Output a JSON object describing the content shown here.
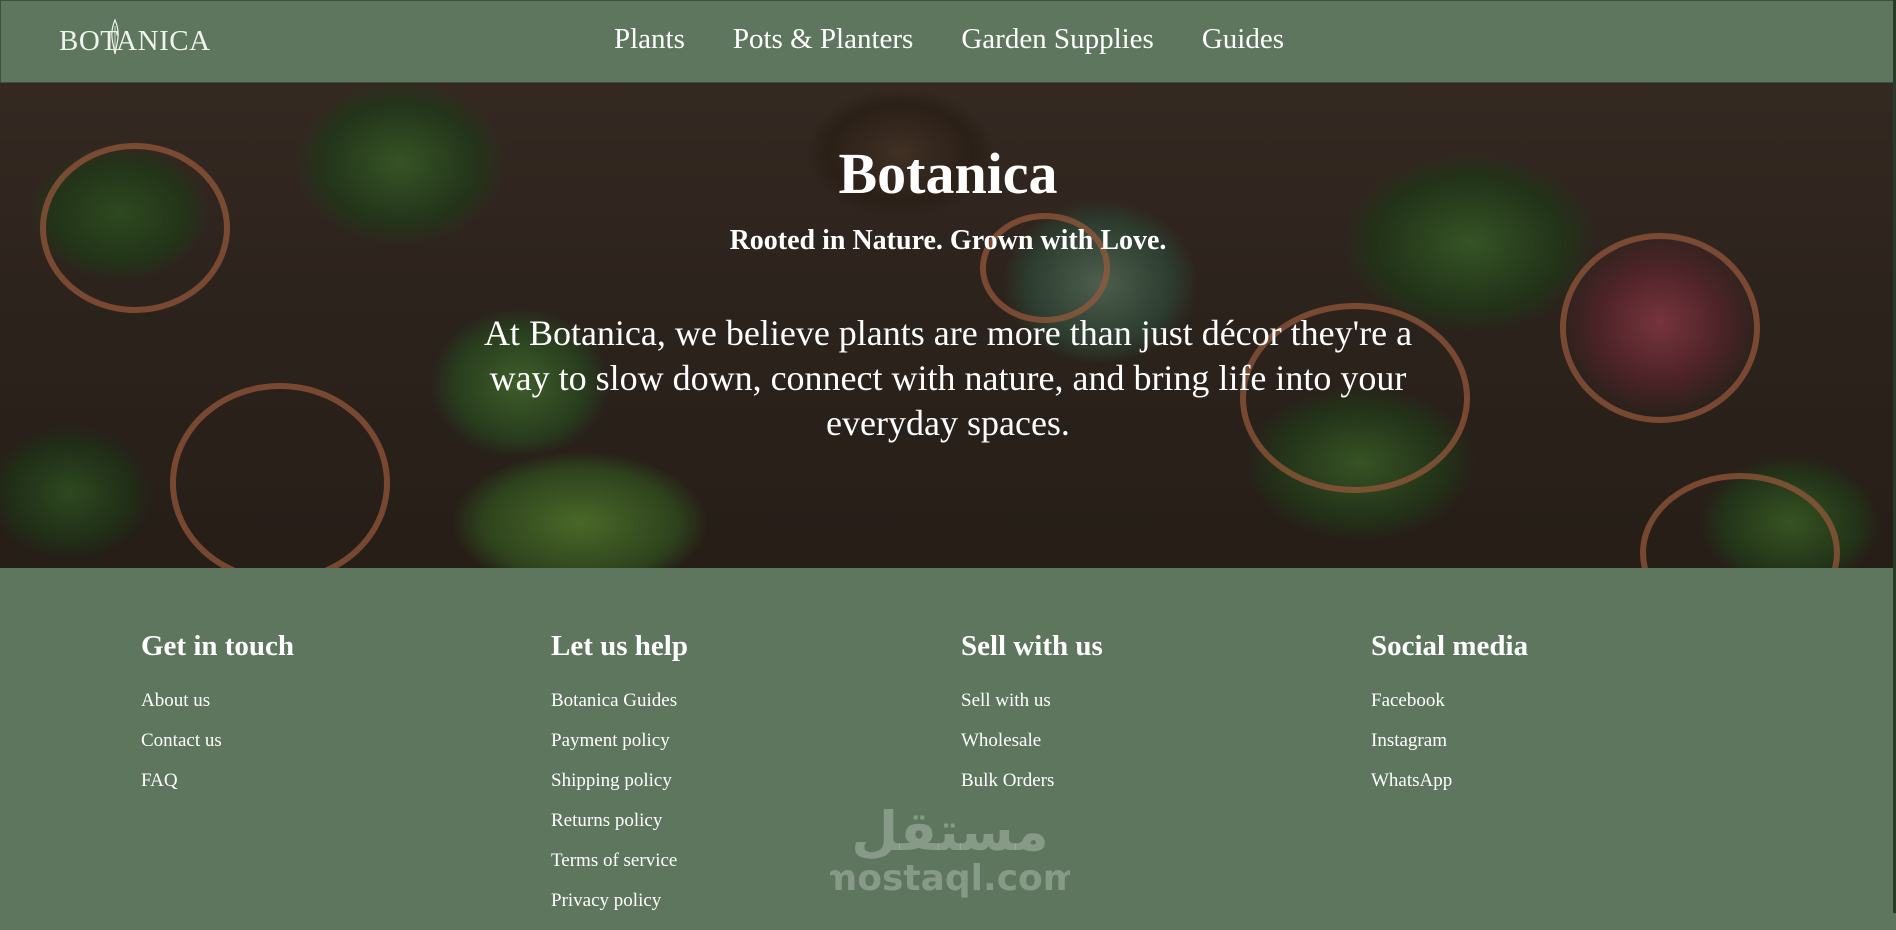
{
  "header": {
    "logo": "BOTANICA",
    "nav": [
      "Plants",
      "Pots & Planters",
      "Garden Supplies",
      "Guides"
    ]
  },
  "hero": {
    "title": "Botanica",
    "tagline": "Rooted in Nature. Grown with Love.",
    "text": "At Botanica, we believe plants are more than just décor they're a way to slow down, connect with nature, and bring life into your everyday spaces."
  },
  "footer": {
    "columns": [
      {
        "heading": "Get in touch",
        "links": [
          "About us",
          "Contact us",
          "FAQ"
        ]
      },
      {
        "heading": "Let us help",
        "links": [
          "Botanica Guides",
          "Payment policy",
          "Shipping policy",
          "Returns policy",
          "Terms of service",
          "Privacy policy"
        ]
      },
      {
        "heading": "Sell with us",
        "links": [
          "Sell with us",
          "Wholesale",
          "Bulk Orders"
        ]
      },
      {
        "heading": "Social media",
        "links": [
          "Facebook",
          "Instagram",
          "WhatsApp"
        ]
      }
    ]
  },
  "watermark": {
    "arabic": "مستقل",
    "latin": "mostaql.com"
  },
  "colors": {
    "header_bg": "#5e765e",
    "footer_bg": "#5e765e",
    "text": "#ffffff"
  }
}
